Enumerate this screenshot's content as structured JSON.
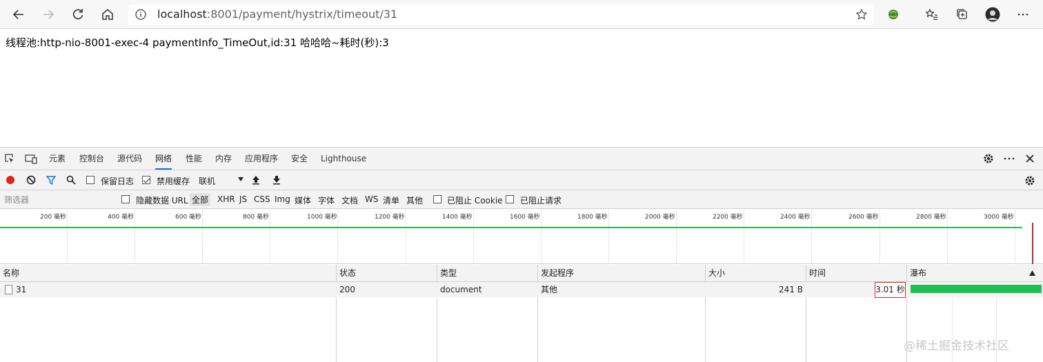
{
  "browser": {
    "url_host": "localhost",
    "url_rest": ":8001/payment/hystrix/timeout/31",
    "buttons": {
      "back": "back-arrow-icon",
      "forward": "forward-arrow-icon",
      "refresh": "refresh-icon",
      "home": "home-icon"
    }
  },
  "page": {
    "text": "线程池:http-nio-8001-exec-4 paymentInfo_TimeOut,id:31 哈哈哈~耗时(秒):3"
  },
  "devtools": {
    "tabs": [
      "元素",
      "控制台",
      "源代码",
      "网络",
      "性能",
      "内存",
      "应用程序",
      "安全",
      "Lighthouse"
    ],
    "active_tab": "网络",
    "toolbar": {
      "preserve_log": "保留日志",
      "disable_cache": "禁用缓存",
      "throttle": "联机"
    },
    "filter": {
      "placeholder": "筛选器",
      "hide_data_url": "隐藏数据 URL",
      "types": [
        "全部",
        "XHR",
        "JS",
        "CSS",
        "Img",
        "媒体",
        "字体",
        "文档",
        "WS",
        "清单",
        "其他"
      ],
      "blocked_cookie": "已阻止 Cookie",
      "blocked_requests": "已阻止请求"
    },
    "overview_ticks": [
      "200 毫秒",
      "400 毫秒",
      "600 毫秒",
      "800 毫秒",
      "1000 毫秒",
      "1200 毫秒",
      "1400 毫秒",
      "1600 毫秒",
      "1800 毫秒",
      "2000 毫秒",
      "2200 毫秒",
      "2400 毫秒",
      "2600 毫秒",
      "2800 毫秒",
      "3000 毫秒"
    ],
    "columns": [
      "名称",
      "状态",
      "类型",
      "发起程序",
      "大小",
      "时间",
      "瀑布"
    ],
    "rows": [
      {
        "name": "31",
        "status": "200",
        "type": "document",
        "initiator": "其他",
        "size": "241 B",
        "time": "3.01 秒"
      }
    ]
  },
  "watermark": "@稀土掘金技术社区",
  "colors": {
    "accent": "#1a73e8",
    "waterfall": "#1fbe52",
    "highlight_box": "#dd2222"
  }
}
